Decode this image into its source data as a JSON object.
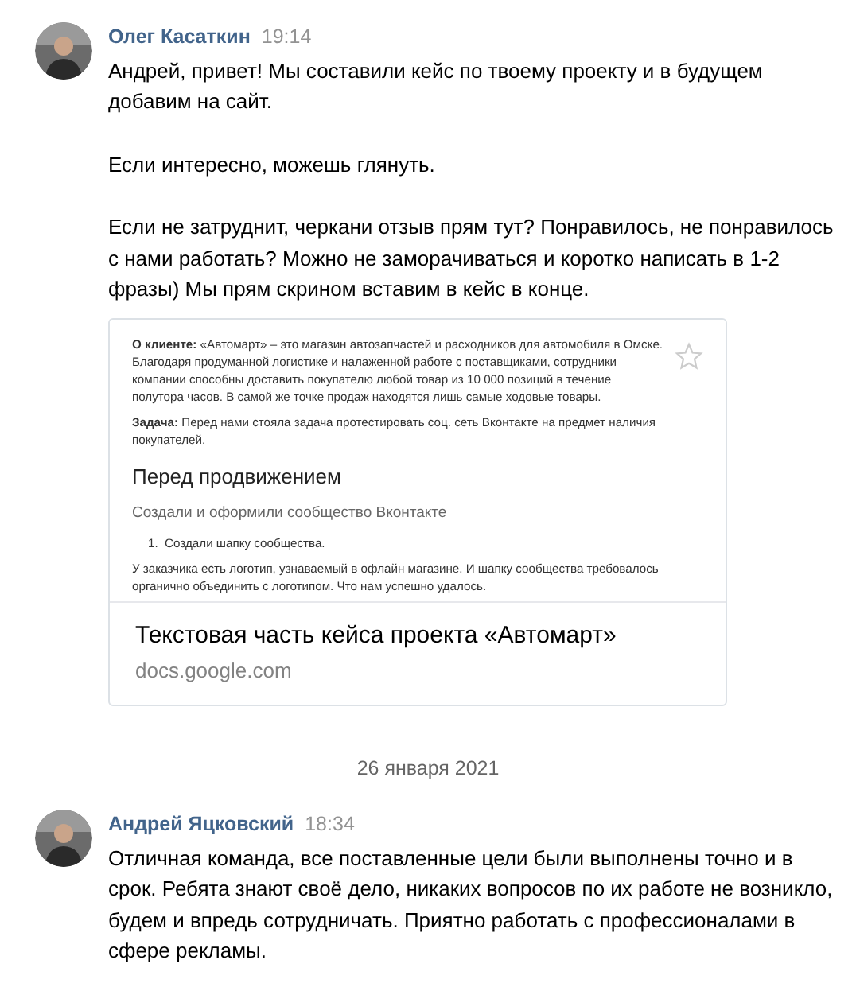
{
  "messages": [
    {
      "author": "Олег Касаткин",
      "time": "19:14",
      "paragraphs": [
        "Андрей, привет! Мы составили кейс по твоему проекту и в будущем добавим на сайт.",
        "Если интересно, можешь глянуть.",
        "Если не затруднит, черкани отзыв прям тут? Понравилось, не понравилось с нами работать? Можно не заморачиваться и коротко написать в 1-2 фразы) Мы прям скрином вставим в кейс в конце."
      ],
      "attachment": {
        "document": {
          "intro": "**О клиенте:** «Автомарт» – это магазин автозапчастей и расходников для автомобиля в Омске. Благодаря продуманной логистике и налаженной работе с поставщиками, сотрудники компании способны доставить покупателю любой товар из 10 000 позиций в течение полутора часов. В самой же точке продаж находятся лишь самые ходовые товары.",
          "task": "**Задача:** Перед нами стояла задача протестировать соц. сеть Вконтакте на предмет наличия покупателей.",
          "heading": "Перед продвижением",
          "subheading": "Создали и оформили сообщество Вконтакте",
          "list_item": "1.  Создали шапку сообщества.",
          "paragraph": "У заказчика есть логотип, узнаваемый в офлайн магазине. И шапку сообщества требовалось органично объединить с логотипом. Что нам успешно удалось."
        },
        "title": "Текстовая часть кейса проекта «Автомарт»",
        "domain": "docs.google.com"
      }
    },
    {
      "kind": "date",
      "text": "26 января 2021"
    },
    {
      "author": "Андрей Яцковский",
      "time": "18:34",
      "paragraphs": [
        "Отличная команда, все поставленные цели были выполнены точно и в срок. Ребята знают своё дело, никаких вопросов по их работе не возникло, будем и впредь сотрудничать. Приятно работать с профессионалами в сфере рекламы."
      ]
    }
  ]
}
